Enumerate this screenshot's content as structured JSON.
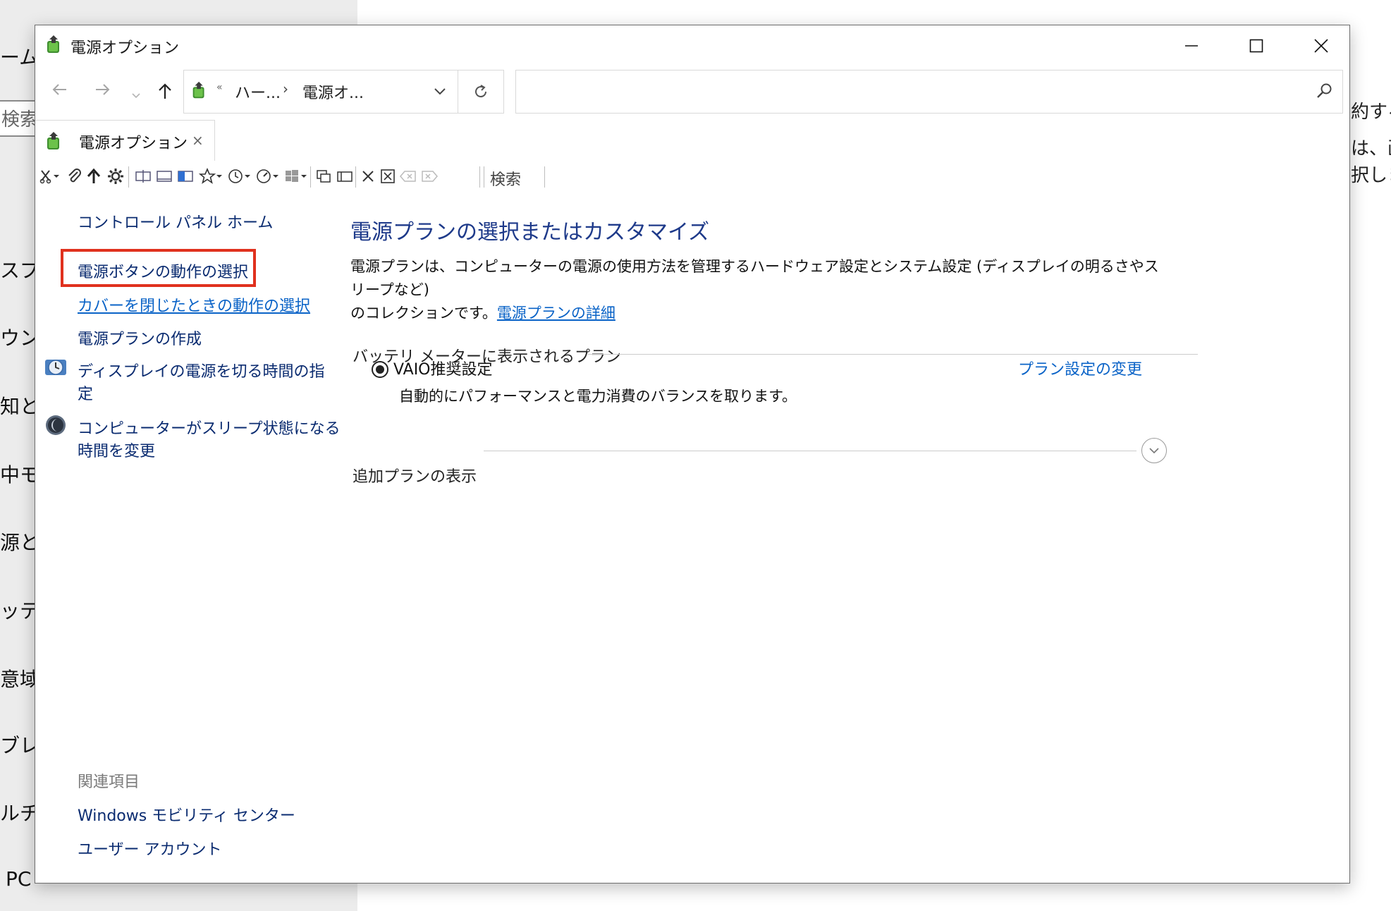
{
  "background": {
    "left_items": [
      "ーム",
      "スプ",
      "ウンド",
      "知とア",
      "中モー",
      "源とス",
      "ッテリ",
      "意域",
      "ブレッ",
      "ルチタ",
      "PC"
    ],
    "search_text": "検索",
    "right_snippets": [
      "約する",
      "は、画",
      "択しま"
    ],
    "help_label": "?"
  },
  "window": {
    "title": "電源オプション",
    "address": {
      "overflow": "«",
      "crumbs": [
        "ハー...",
        "電源オ..."
      ],
      "chevron": "›"
    },
    "search_placeholder": "",
    "tab": {
      "label": "電源オプション",
      "close": "×"
    },
    "toolbar": {
      "search_label": "検索"
    }
  },
  "left_pane": {
    "home": "コントロール パネル ホーム",
    "links": [
      "電源ボタンの動作の選択",
      "カバーを閉じたときの動作の選択",
      "電源プランの作成",
      "ディスプレイの電源を切る時間の指",
      "定",
      "コンピューターがスリープ状態になる",
      "時間を変更"
    ],
    "related_title": "関連項目",
    "related": [
      "Windows モビリティ センター",
      "ユーザー アカウント"
    ]
  },
  "main": {
    "heading": "電源プランの選択またはカスタマイズ",
    "desc_line1": "電源プランは、コンピューターの電源の使用方法を管理するハードウェア設定とシステム設定 (ディスプレイの明るさやスリープなど)",
    "desc_line2": "のコレクションです。",
    "desc_link": "電源プランの詳細",
    "battery_group": "バッテリ メーターに表示されるプラン",
    "plan": {
      "name": "VAIO推奨設定",
      "description": "自動的にパフォーマンスと電力消費のバランスを取ります。",
      "change_link": "プラン設定の変更",
      "selected": true
    },
    "more_plans": "追加プランの表示"
  },
  "colors": {
    "link_dark": "#0a2b70",
    "link_blue": "#0a63c7",
    "heading": "#1e3a8a",
    "highlight": "#e0311e"
  }
}
